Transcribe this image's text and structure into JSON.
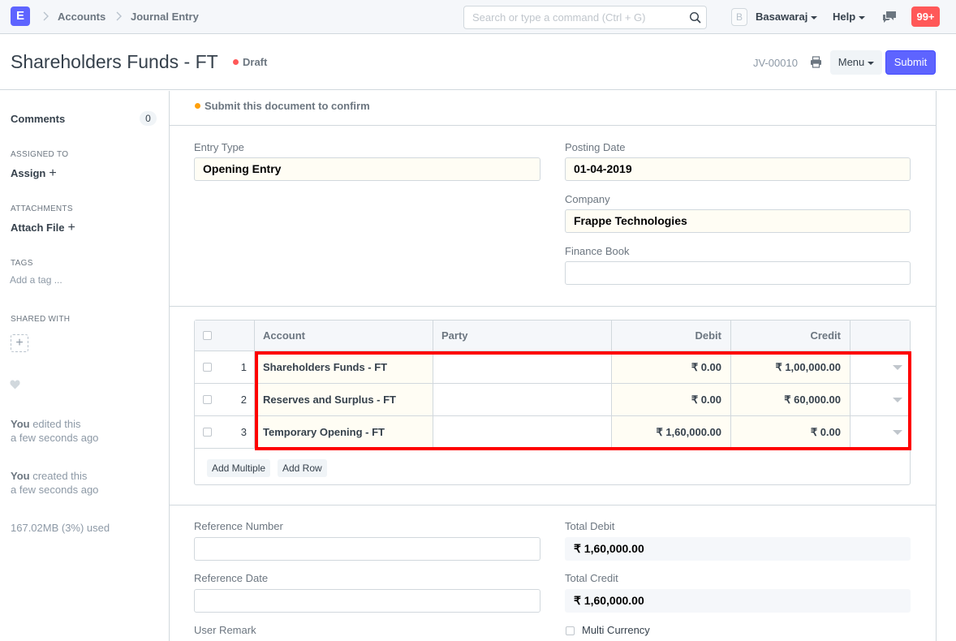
{
  "navbar": {
    "logo": "E",
    "breadcrumbs": [
      "Accounts",
      "Journal Entry"
    ],
    "search_placeholder": "Search or type a command (Ctrl + G)",
    "avatar_letter": "B",
    "user": "Basawaraj",
    "help": "Help",
    "notifications": "99+"
  },
  "header": {
    "title": "Shareholders Funds - FT",
    "status": "Draft",
    "docname": "JV-00010",
    "menu_label": "Menu",
    "submit_label": "Submit"
  },
  "sidebar": {
    "comments_label": "Comments",
    "comments_count": "0",
    "assigned_to_label": "ASSIGNED TO",
    "assign_label": "Assign",
    "attachments_label": "ATTACHMENTS",
    "attach_label": "Attach File",
    "tags_label": "TAGS",
    "add_tag": "Add a tag ...",
    "shared_with_label": "SHARED WITH",
    "activity": [
      {
        "who": "You",
        "what": " edited this",
        "when": "a few seconds ago"
      },
      {
        "who": "You",
        "what": " created this",
        "when": "a few seconds ago"
      }
    ],
    "storage": "167.02MB (3%) used"
  },
  "main": {
    "message": "Submit this document to confirm",
    "entry_type_label": "Entry Type",
    "entry_type_value": "Opening Entry",
    "posting_date_label": "Posting Date",
    "posting_date_value": "01-04-2019",
    "company_label": "Company",
    "company_value": "Frappe Technologies",
    "finance_book_label": "Finance Book",
    "finance_book_value": "",
    "table": {
      "columns": [
        "Account",
        "Party",
        "Debit",
        "Credit"
      ],
      "rows": [
        {
          "no": "1",
          "account": "Shareholders Funds - FT",
          "party": "",
          "debit": "₹ 0.00",
          "credit": "₹ 1,00,000.00"
        },
        {
          "no": "2",
          "account": "Reserves and Surplus - FT",
          "party": "",
          "debit": "₹ 0.00",
          "credit": "₹ 60,000.00"
        },
        {
          "no": "3",
          "account": "Temporary Opening - FT",
          "party": "",
          "debit": "₹ 1,60,000.00",
          "credit": "₹ 0.00"
        }
      ],
      "add_multiple": "Add Multiple",
      "add_row": "Add Row"
    },
    "reference_number_label": "Reference Number",
    "reference_date_label": "Reference Date",
    "user_remark_label": "User Remark",
    "total_debit_label": "Total Debit",
    "total_debit_value": "₹ 1,60,000.00",
    "total_credit_label": "Total Credit",
    "total_credit_value": "₹ 1,60,000.00",
    "multi_currency_label": "Multi Currency"
  },
  "colors": {
    "primary": "#5e64ff",
    "draft": "#ff5858",
    "indicator_orange": "#ffa00a",
    "highlight_border": "#ff0000"
  }
}
